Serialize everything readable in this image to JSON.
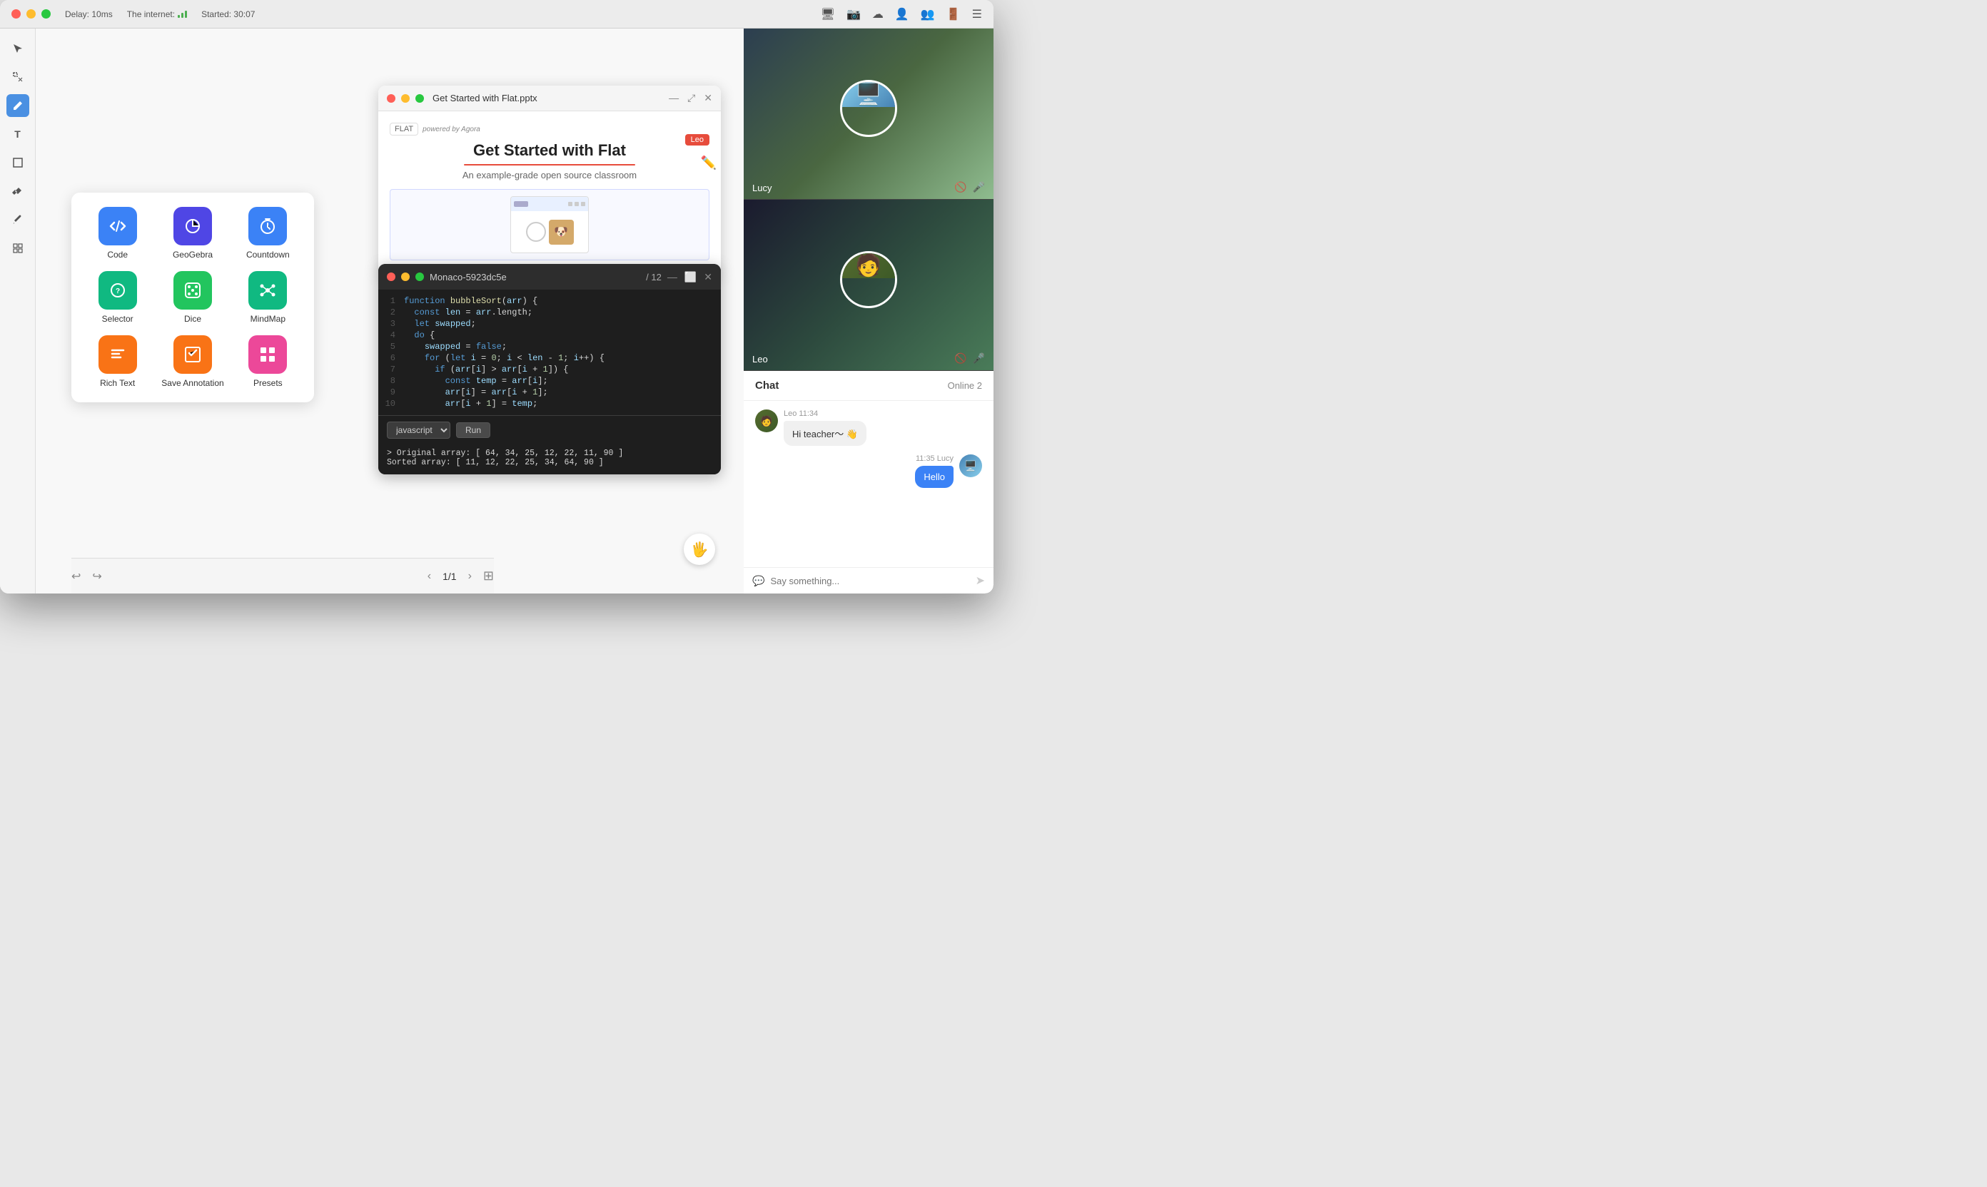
{
  "titlebar": {
    "delay_label": "Delay: 10ms",
    "internet_label": "The internet:",
    "started_label": "Started: 30:07"
  },
  "toolbar": {
    "buttons": [
      {
        "name": "cursor",
        "icon": "⬆",
        "active": false
      },
      {
        "name": "select",
        "icon": "⬚",
        "active": false
      },
      {
        "name": "pen",
        "icon": "✏",
        "active": true
      },
      {
        "name": "text",
        "icon": "T",
        "active": false
      },
      {
        "name": "shape",
        "icon": "□",
        "active": false
      },
      {
        "name": "eraser",
        "icon": "⌫",
        "active": false
      },
      {
        "name": "brush",
        "icon": "⚡",
        "active": false
      },
      {
        "name": "grid",
        "icon": "⊞",
        "active": false
      }
    ]
  },
  "plugins": {
    "items": [
      {
        "name": "Code",
        "icon": "code",
        "color": "#3b82f6"
      },
      {
        "name": "GeoGebra",
        "icon": "geogebra",
        "color": "#4f46e5"
      },
      {
        "name": "Countdown",
        "icon": "countdown",
        "color": "#3b82f6"
      },
      {
        "name": "Selector",
        "icon": "selector",
        "color": "#10b981"
      },
      {
        "name": "Dice",
        "icon": "dice",
        "color": "#22c55e"
      },
      {
        "name": "MindMap",
        "icon": "mindmap",
        "color": "#10b981"
      },
      {
        "name": "Rich Text",
        "icon": "richtext",
        "color": "#f97316"
      },
      {
        "name": "Save Annotation",
        "icon": "annotation",
        "color": "#f97316"
      },
      {
        "name": "Presets",
        "icon": "presets",
        "color": "#ec4899"
      }
    ]
  },
  "presentation_window": {
    "title": "Get Started with Flat.pptx",
    "slide_title": "Get Started with Flat",
    "slide_subtitle": "An example-grade open source classroom",
    "user_badge": "Leo",
    "logo": "FLAT"
  },
  "code_window": {
    "title": "Monaco-5923dc5e",
    "page": "/ 12",
    "lines": [
      {
        "num": 1,
        "code": "function bubbleSort(arr) {"
      },
      {
        "num": 2,
        "code": "  const len = arr.length;"
      },
      {
        "num": 3,
        "code": "  let swapped;"
      },
      {
        "num": 4,
        "code": "  do {"
      },
      {
        "num": 5,
        "code": "    swapped = false;"
      },
      {
        "num": 6,
        "code": "    for (let i = 0; i < len - 1; i++) {"
      },
      {
        "num": 7,
        "code": "      if (arr[i] > arr[i + 1]) {"
      },
      {
        "num": 8,
        "code": "        const temp = arr[i];"
      },
      {
        "num": 9,
        "code": "        arr[i] = arr[i + 1];"
      },
      {
        "num": 10,
        "code": "        arr[i + 1] = temp;"
      }
    ],
    "language": "javascript",
    "run_button": "Run",
    "output_line1": "> Original array: [ 64, 34, 25, 12, 22, 11, 90 ]",
    "output_line2": "  Sorted array: [ 11, 12, 22, 25, 34, 64, 90 ]"
  },
  "bottom_bar": {
    "page_current": "1/1",
    "back_btn": "‹",
    "forward_btn": "›"
  },
  "video_panel": {
    "lucy_name": "Lucy",
    "leo_name": "Leo"
  },
  "chat": {
    "title": "Chat",
    "online": "Online 2",
    "messages": [
      {
        "sender": "Leo",
        "time": "11:34",
        "text": "Hi teacher～ 👋",
        "side": "left"
      },
      {
        "sender": "Lucy",
        "time": "11:35",
        "text": "Hello",
        "side": "right"
      }
    ],
    "input_placeholder": "Say something..."
  }
}
